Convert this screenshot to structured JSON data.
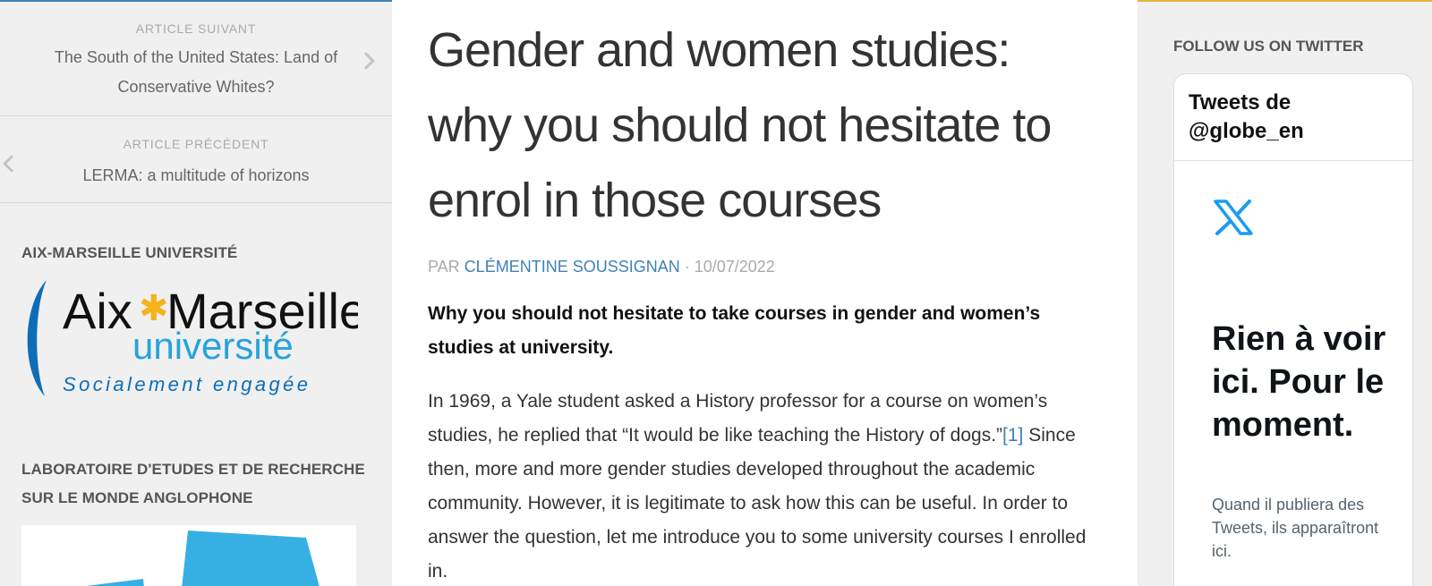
{
  "left_sidebar": {
    "next": {
      "kicker": "ARTICLE SUIVANT",
      "title": "The South of the United States: Land of Conservative Whites?"
    },
    "prev": {
      "kicker": "ARTICLE PRÉCÉDENT",
      "title": "LERMA: a multitude of horizons"
    },
    "amu_widget": {
      "title": "AIX-MARSEILLE UNIVERSITÉ",
      "logo": {
        "line1_left": "Aix",
        "line1_right": "Marseille",
        "line2": "université",
        "line3": "Socialement engagée"
      }
    },
    "lerma_widget": {
      "title": "LABORATOIRE D'ETUDES ET DE RECHERCHE SUR LE MONDE ANGLOPHONE"
    }
  },
  "article": {
    "title": "Gender and women studies: why you should not hesitate to enrol in those courses",
    "byline_prefix": "PAR ",
    "author": "CLÉMENTINE SOUSSIGNAN",
    "separator": " · ",
    "date": "10/07/2022",
    "lead": "Why you should not hesitate to take courses in gender and women’s studies at university.",
    "body_part1": "In 1969, a Yale student asked a History professor for a course on women’s studies, he replied that “It would be like teaching the History of dogs.”",
    "ref_marker": "[1]",
    "body_part2": " Since then, more and more gender studies developed throughout the academic community. However, it is legitimate to ask how this can be useful. In order to answer the question, let me introduce you to some university courses I enrolled in."
  },
  "right_sidebar": {
    "title": "FOLLOW US ON TWITTER",
    "tweets_header": "Tweets de @globe_en",
    "empty_title": "Rien à voir ici. Pour le moment.",
    "empty_note": "Quand il publiera des Tweets, ils apparaîtront ici."
  },
  "colors": {
    "link": "#3f81b8",
    "amu_blue": "#0d6eb7",
    "amu_light_blue": "#26a3dc",
    "amu_star": "#f5b21b",
    "x_blue": "#1d9bf0",
    "accent_right": "#e8b23a"
  },
  "icons": {
    "next": "chevron-right-icon",
    "prev": "chevron-left-icon",
    "x": "x-logo-icon"
  }
}
